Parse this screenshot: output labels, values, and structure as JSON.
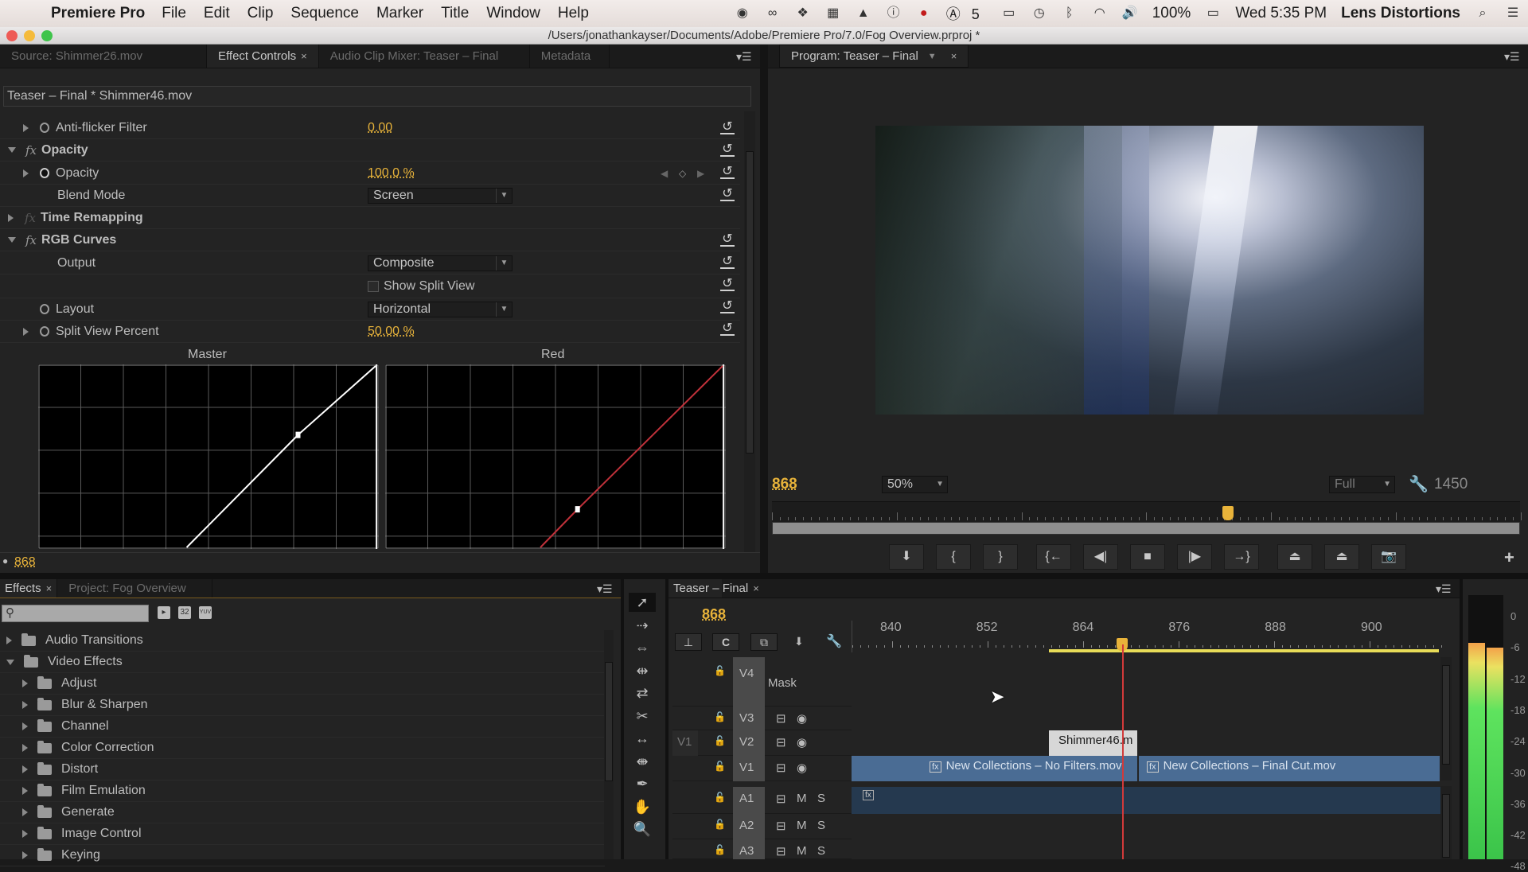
{
  "menubar": {
    "app": "Premiere Pro",
    "items": [
      "File",
      "Edit",
      "Clip",
      "Sequence",
      "Marker",
      "Title",
      "Window",
      "Help"
    ],
    "status": {
      "badge_count": "5",
      "battery": "100%",
      "clock": "Wed 5:35 PM",
      "user": "Lens Distortions"
    }
  },
  "window": {
    "title": "/Users/jonathankayser/Documents/Adobe/Premiere Pro/7.0/Fog Overview.prproj *"
  },
  "top_left_tabs": [
    {
      "label": "Source: Shimmer26.mov"
    },
    {
      "label": "Effect Controls",
      "active": true
    },
    {
      "label": "Audio Clip Mixer: Teaser – Final"
    },
    {
      "label": "Metadata"
    }
  ],
  "effect_controls": {
    "header": "Teaser – Final * Shimmer46.mov",
    "rows": [
      {
        "label": "Anti-flicker Filter",
        "value": "0.00"
      },
      {
        "label": "Opacity",
        "section": true
      },
      {
        "label": "Opacity",
        "value": "100.0 %"
      },
      {
        "label": "Blend Mode",
        "dropdown": "Screen"
      },
      {
        "label": "Time Remapping",
        "section": true
      },
      {
        "label": "RGB Curves",
        "section": true
      },
      {
        "label": "Output",
        "dropdown": "Composite"
      },
      {
        "checkbox": "Show Split View",
        "checked": false
      },
      {
        "label": "Layout",
        "dropdown": "Horizontal"
      },
      {
        "label": "Split View Percent",
        "value": "50.00 %"
      }
    ],
    "curves": [
      {
        "name": "Master",
        "color": "#ffffff",
        "points": [
          [
            0.44,
            0
          ],
          [
            0.77,
            0.62
          ],
          [
            1,
            1
          ]
        ]
      },
      {
        "name": "Red",
        "color": "#c0313a",
        "points": [
          [
            0.46,
            0
          ],
          [
            0.57,
            0.21
          ],
          [
            1,
            1
          ]
        ]
      }
    ],
    "timecode": "868"
  },
  "program": {
    "tab": "Program: Teaser – Final",
    "timecode": "868",
    "zoom": "50%",
    "quality": "Full",
    "duration": "1450",
    "playhead_fraction": 0.61,
    "buttons": [
      "add-marker",
      "mark-in",
      "mark-out",
      "go-to-in",
      "step-back",
      "stop",
      "step-forward",
      "go-to-out",
      "lift",
      "extract",
      "export-frame"
    ],
    "button_glyphs": [
      "⬇",
      "{",
      "}",
      "{←",
      "◀|",
      "■",
      "|▶",
      "→}",
      "⏏",
      "⏏",
      "📷"
    ],
    "add_label": "+"
  },
  "effects_panel": {
    "tabs": [
      {
        "label": "Effects",
        "active": true
      },
      {
        "label": "Project: Fog Overview"
      }
    ],
    "search_placeholder": "",
    "filter_buttons": [
      "accelerated",
      "32",
      "YUV"
    ],
    "items": [
      {
        "label": "Audio Transitions",
        "level": 0,
        "expanded": false
      },
      {
        "label": "Video Effects",
        "level": 0,
        "expanded": true
      },
      {
        "label": "Adjust",
        "level": 1
      },
      {
        "label": "Blur & Sharpen",
        "level": 1
      },
      {
        "label": "Channel",
        "level": 1
      },
      {
        "label": "Color Correction",
        "level": 1
      },
      {
        "label": "Distort",
        "level": 1
      },
      {
        "label": "Film Emulation",
        "level": 1
      },
      {
        "label": "Generate",
        "level": 1
      },
      {
        "label": "Image Control",
        "level": 1
      },
      {
        "label": "Keying",
        "level": 1
      }
    ]
  },
  "tools": [
    "selection",
    "track-select",
    "ripple-edit",
    "rolling-edit",
    "rate-stretch",
    "razor",
    "slip",
    "slide",
    "pen",
    "hand",
    "zoom"
  ],
  "timeline": {
    "tab": "Teaser – Final",
    "timecode": "868",
    "ruler": [
      "840",
      "852",
      "864",
      "876",
      "888",
      "900"
    ],
    "tracks": [
      {
        "name": "V4",
        "label": "Mask"
      },
      {
        "name": "V3"
      },
      {
        "name": "V2",
        "source": "V1"
      },
      {
        "name": "V1"
      },
      {
        "name": "A1",
        "m": "M",
        "s": "S"
      },
      {
        "name": "A2",
        "m": "M",
        "s": "S"
      },
      {
        "name": "A3",
        "m": "M",
        "s": "S"
      }
    ],
    "clips": {
      "v2": "Shimmer46.m",
      "v1a": "New Collections – No Filters.mov",
      "v1b": "New Collections – Final Cut.mov"
    }
  },
  "audio_meter": {
    "labels": [
      "0",
      "-6",
      "-12",
      "-18",
      "-24",
      "-30",
      "-36",
      "-42",
      "-48"
    ],
    "levels_db": [
      -5,
      -6
    ]
  }
}
